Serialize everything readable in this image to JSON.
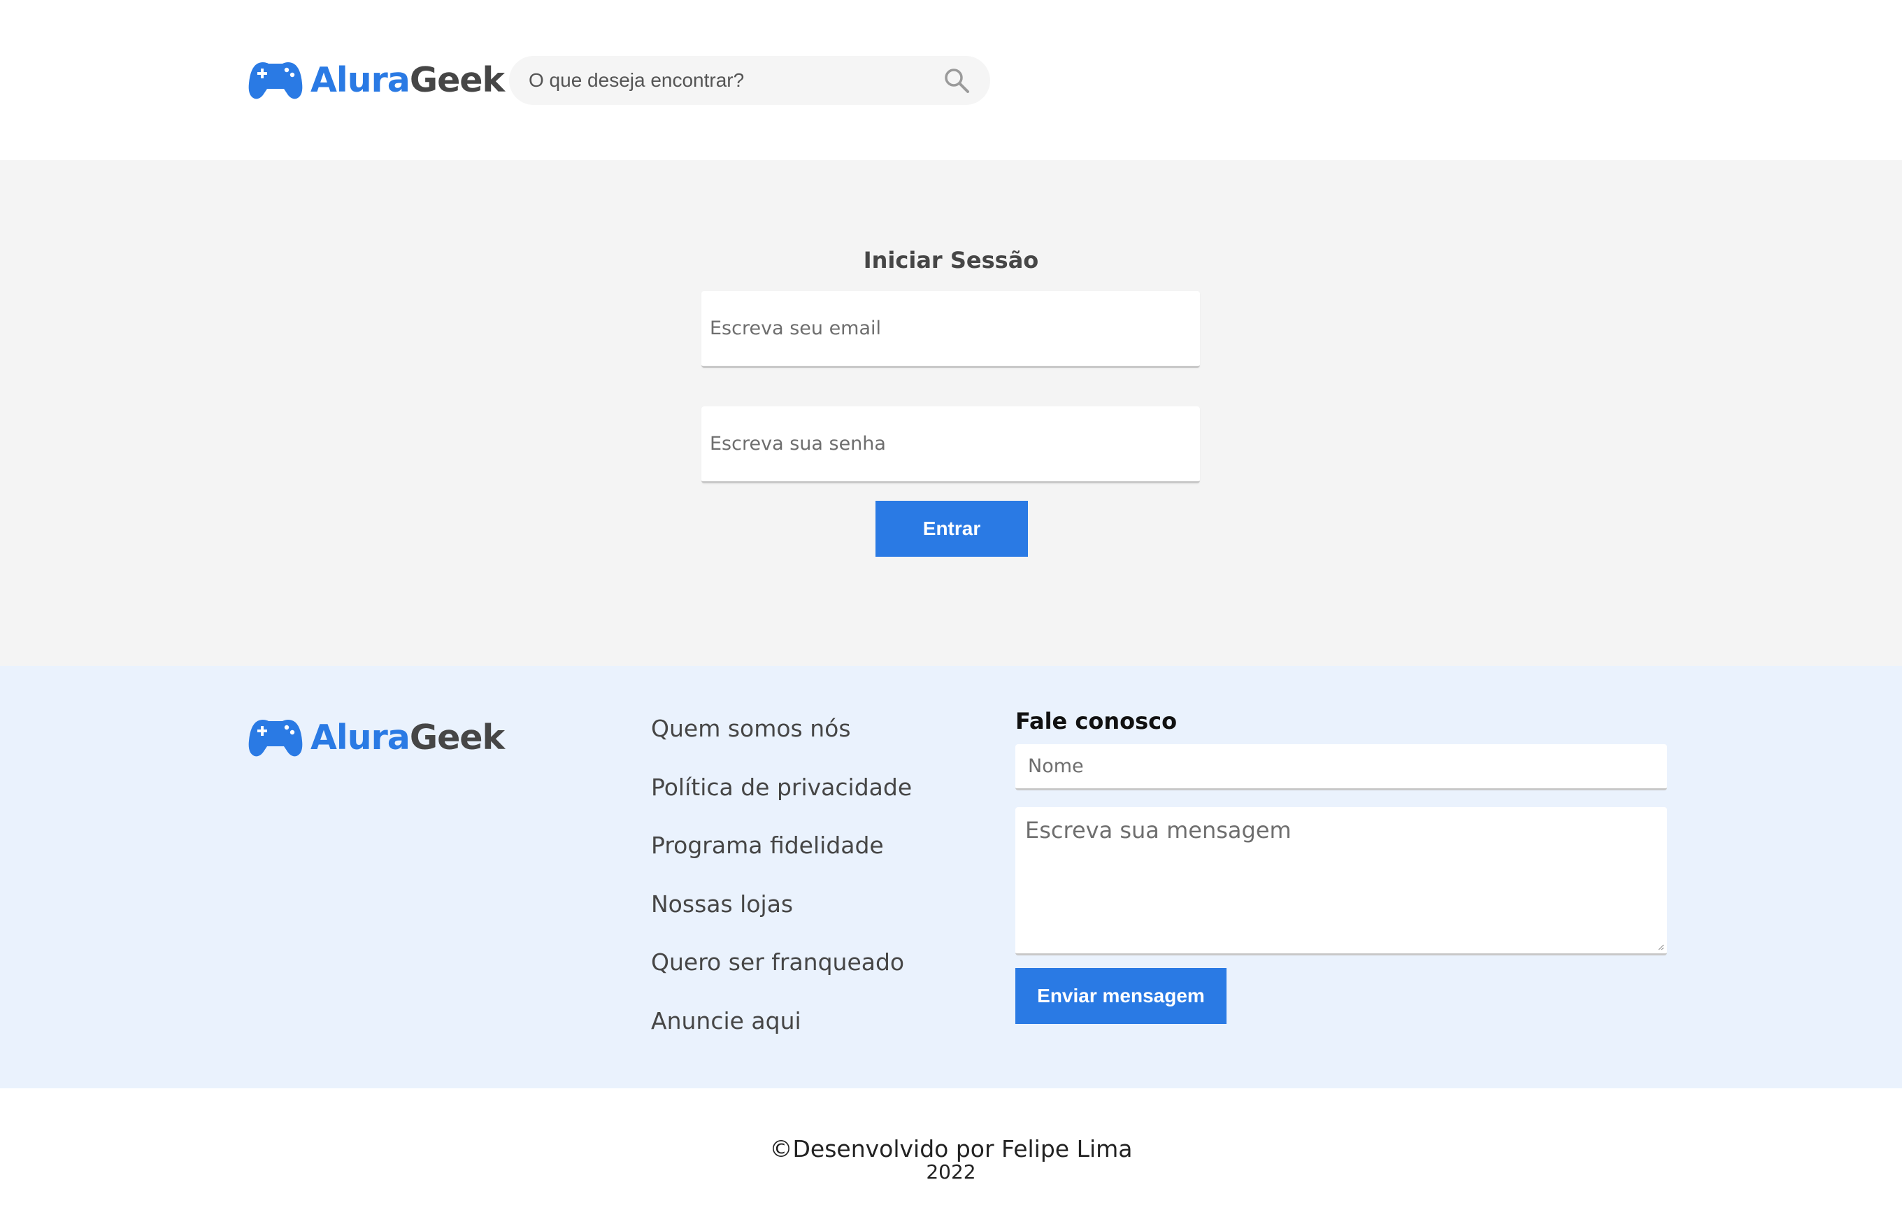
{
  "brand": {
    "part1": "Alura",
    "part2": "Geek",
    "logo_icon": "gamepad-icon",
    "accent_color": "#2a7ae4"
  },
  "header": {
    "search": {
      "placeholder": "O que deseja encontrar?",
      "icon": "search-icon"
    }
  },
  "login": {
    "title": "Iniciar Sessão",
    "email_placeholder": "Escreva seu email",
    "password_placeholder": "Escreva sua senha",
    "submit_label": "Entrar"
  },
  "footer": {
    "links": [
      "Quem somos nós",
      "Política de privacidade",
      "Programa fidelidade",
      "Nossas lojas",
      "Quero ser franqueado",
      "Anuncie aqui"
    ],
    "contact": {
      "title": "Fale conosco",
      "name_placeholder": "Nome",
      "message_placeholder": "Escreva sua mensagem",
      "submit_label": "Enviar mensagem"
    }
  },
  "credits": {
    "line1": "©Desenvolvido por Felipe Lima",
    "line2": "2022"
  }
}
